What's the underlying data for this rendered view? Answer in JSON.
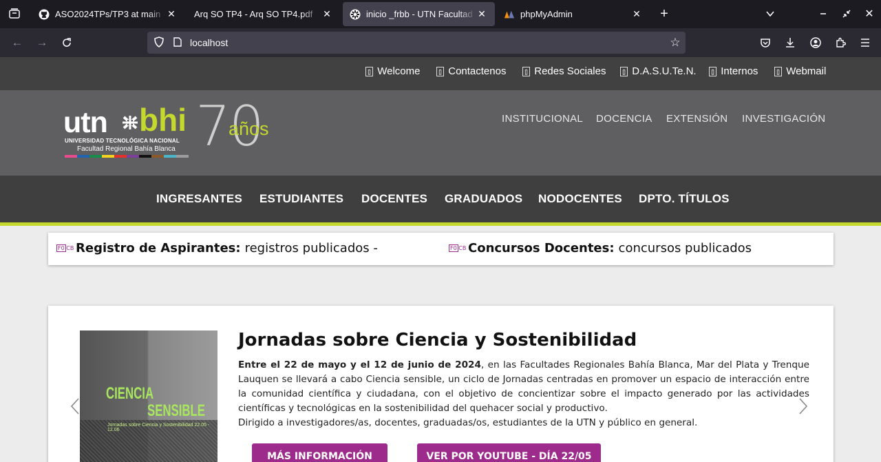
{
  "browser": {
    "tabs": [
      {
        "title": "ASO2024TPs/TP3 at main · Ga",
        "icon": "github-icon",
        "active": false
      },
      {
        "title": "Arq SO TP4 - Arq SO TP4.pdf",
        "icon": "",
        "active": false
      },
      {
        "title": "inicio _frbb - UTN Facultad Re",
        "icon": "utn-icon",
        "active": true
      },
      {
        "title": "phpMyAdmin",
        "icon": "phpmyadmin-icon",
        "active": false
      }
    ],
    "url": "localhost"
  },
  "site": {
    "top_links": [
      "Welcome",
      "Contactenos",
      "Redes Sociales",
      "D.A.S.U.Te.N.",
      "Internos",
      "Webmail"
    ],
    "logo": {
      "utn": "utn",
      "bhi": "bhi",
      "line1": "UNIVERSIDAD TECNOLÓGICA NACIONAL",
      "line2": "Facultad Regional Bahía Blanca",
      "seventy": "70",
      "anos": "años",
      "strip_colors": [
        "#e94b8f",
        "#2364b0",
        "#1a8c4a",
        "#f4d41e",
        "#e5312b",
        "#7b3f99",
        "#111111",
        "#8b5a2b",
        "#49b6c9",
        "#9d9d9d"
      ]
    },
    "header_links": [
      "INSTITUCIONAL",
      "DOCENCIA",
      "EXTENSIÓN",
      "INVESTIGACIÓN"
    ],
    "main_nav": [
      "INGRESANTES",
      "ESTUDIANTES",
      "DOCENTES",
      "GRADUADOS",
      "NODOCENTES",
      "DPTO. TÍTULOS"
    ],
    "accent_color": "#c4d82e",
    "ticker": [
      {
        "label": "Registro de Aspirantes:",
        "text": "registros publicados -"
      },
      {
        "label": "Concursos Docentes:",
        "text": "concursos publicados"
      }
    ],
    "news": {
      "title": "Jornadas sobre Ciencia y Sostenibilidad",
      "body_bold": "Entre el 22 de mayo y el 12 de junio de 2024",
      "body_rest": ", en las Facultades Regionales Bahía Blanca, Mar del Plata y Trenque Lauquen se llevará a cabo Ciencia sensible, un ciclo de Jornadas centradas en promover un espacio de interacción entre la comunidad científica y ciudadana, con el objetivo de concientizar sobre el impacto generado por las actividades científicas y tecnológicas en la sostenibilidad del quehacer social y productivo.",
      "body_p2": "Dirigido a investigadores/as, docentes, graduadas/os, estudiantes de la UTN y público en general.",
      "poster_title1": "CIENCIA",
      "poster_title2": "SENSIBLE",
      "poster_sub": "Jornadas sobre Ciencia y Sostenibilidad 22.05 - 12.06",
      "buttons": [
        "MÁS INFORMACIÓN",
        "VER POR YOUTUBE - DÍA 22/05"
      ],
      "button_color": "#9d2b8b"
    }
  }
}
